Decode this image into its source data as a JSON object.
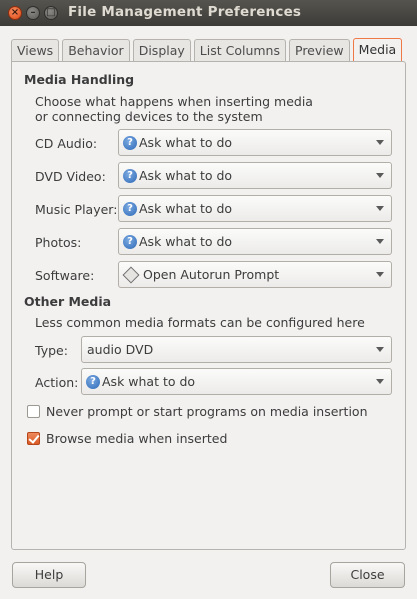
{
  "window": {
    "title": "File Management Preferences",
    "controls": {
      "close": "×",
      "minimize": "–",
      "maximize": "□"
    }
  },
  "tabs": [
    {
      "label": "Views"
    },
    {
      "label": "Behavior"
    },
    {
      "label": "Display"
    },
    {
      "label": "List Columns"
    },
    {
      "label": "Preview"
    },
    {
      "label": "Media",
      "active": true
    }
  ],
  "media_handling": {
    "heading": "Media Handling",
    "description_line1": "Choose what happens when inserting media",
    "description_line2": "or connecting devices to the system",
    "rows": [
      {
        "label": "CD Audio:",
        "value": "Ask what to do",
        "icon": "question-icon"
      },
      {
        "label": "DVD Video:",
        "value": "Ask what to do",
        "icon": "question-icon"
      },
      {
        "label": "Music Player:",
        "value": "Ask what to do",
        "icon": "question-icon"
      },
      {
        "label": "Photos:",
        "value": "Ask what to do",
        "icon": "question-icon"
      },
      {
        "label": "Software:",
        "value": "Open Autorun Prompt",
        "icon": "autorun-icon"
      }
    ]
  },
  "other_media": {
    "heading": "Other Media",
    "description": "Less common media formats can be configured here",
    "type_label": "Type:",
    "type_value": "audio DVD",
    "action_label": "Action:",
    "action_value": "Ask what to do"
  },
  "options": {
    "never_prompt": {
      "label": "Never prompt or start programs on media insertion",
      "checked": false
    },
    "browse_media": {
      "label": "Browse media when inserted",
      "checked": true
    }
  },
  "buttons": {
    "help": "Help",
    "close": "Close"
  },
  "colors": {
    "accent": "#f07746",
    "titlebar": "#3d3b37",
    "background": "#f2f1f0"
  }
}
